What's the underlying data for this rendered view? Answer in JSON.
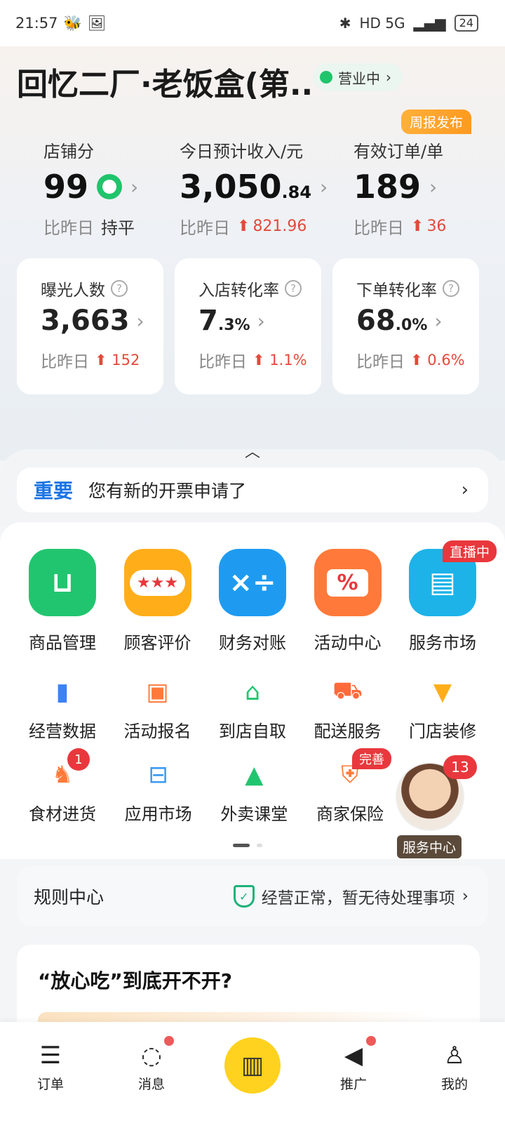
{
  "status_bar": {
    "time": "21:57",
    "network": "HD 5G",
    "battery": "24"
  },
  "header": {
    "store_name": "回忆二厂·老饭盒(第...",
    "store_status": "营业中",
    "weekly_badge": "周报发布"
  },
  "metrics": [
    {
      "label": "店铺分",
      "value": "99",
      "cmp_prefix": "比昨日",
      "cmp_value": "持平"
    },
    {
      "label": "今日预计收入/元",
      "value": "3,050",
      "value_decimal": ".84",
      "cmp_prefix": "比昨日",
      "cmp_value": "821.96"
    },
    {
      "label": "有效订单/单",
      "value": "189",
      "cmp_prefix": "比昨日",
      "cmp_value": "36"
    }
  ],
  "cards": [
    {
      "label": "曝光人数",
      "value": "3,663",
      "value_suffix": "",
      "cmp_prefix": "比昨日",
      "cmp_value": "152"
    },
    {
      "label": "入店转化率",
      "value": "7",
      "value_suffix": ".3%",
      "cmp_prefix": "比昨日",
      "cmp_value": "1.1%"
    },
    {
      "label": "下单转化率",
      "value": "68",
      "value_suffix": ".0%",
      "cmp_prefix": "比昨日",
      "cmp_value": "0.6%"
    }
  ],
  "notice": {
    "tag": "重要",
    "text": "您有新的开票申请了"
  },
  "big_tools": [
    {
      "label": "商品管理",
      "icon": "shopping-bag-icon",
      "color": "#22c56f"
    },
    {
      "label": "顾客评价",
      "icon": "rating-bubble-icon",
      "color": "#ffae1a"
    },
    {
      "label": "财务对账",
      "icon": "calculator-icon",
      "color": "#1e9bf0"
    },
    {
      "label": "活动中心",
      "icon": "coupon-icon",
      "color": "#ff7a3a"
    },
    {
      "label": "服务市场",
      "icon": "basket-icon",
      "color": "#1db3e8",
      "badge": "直播中"
    }
  ],
  "small_tools_row1": [
    {
      "label": "经营数据",
      "icon": "bar-chart-icon"
    },
    {
      "label": "活动报名",
      "icon": "calendar-check-icon"
    },
    {
      "label": "到店自取",
      "icon": "storefront-icon"
    },
    {
      "label": "配送服务",
      "icon": "scooter-icon"
    },
    {
      "label": "门店装修",
      "icon": "paint-brush-icon"
    }
  ],
  "small_tools_row2": [
    {
      "label": "食材进货",
      "icon": "carrot-icon",
      "badge": "1"
    },
    {
      "label": "应用市场",
      "icon": "app-basket-icon"
    },
    {
      "label": "外卖课堂",
      "icon": "graduation-cap-icon"
    },
    {
      "label": "商家保险",
      "icon": "shield-plus-icon",
      "badge": "完善"
    }
  ],
  "service_center": {
    "label": "服务中心",
    "badge": "13"
  },
  "rules": {
    "title": "规则中心",
    "status": "经营正常，暂无待处理事项"
  },
  "article": {
    "title": "“放心吃”到底开不开?"
  },
  "tabbar": [
    {
      "label": "订单",
      "icon": "order-icon"
    },
    {
      "label": "消息",
      "icon": "message-icon",
      "dot": true
    },
    {
      "label": "",
      "icon": "store-center-icon"
    },
    {
      "label": "推广",
      "icon": "megaphone-icon",
      "dot": true
    },
    {
      "label": "我的",
      "icon": "profile-icon"
    }
  ]
}
